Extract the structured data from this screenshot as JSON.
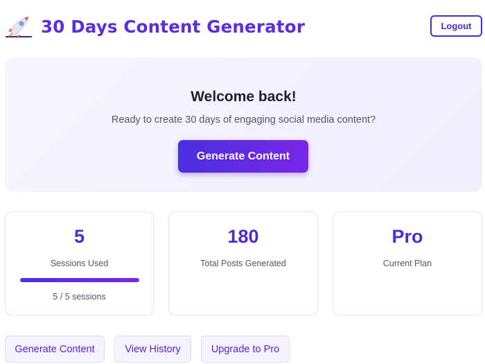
{
  "header": {
    "app_title": "30 Days Content Generator",
    "logo_icon": "rocket-icon",
    "logout_label": "Logout"
  },
  "welcome": {
    "title": "Welcome back!",
    "subtitle": "Ready to create 30 days of engaging social media content?",
    "generate_label": "Generate Content"
  },
  "stats": {
    "sessions": {
      "value": "5",
      "label": "Sessions Used",
      "progress_fraction": 1.0,
      "progress_text": "5 / 5 sessions"
    },
    "posts": {
      "value": "180",
      "label": "Total Posts Generated"
    },
    "plan": {
      "value": "Pro",
      "label": "Current Plan"
    }
  },
  "actions": [
    {
      "label": "Generate Content"
    },
    {
      "label": "View History"
    },
    {
      "label": "Upgrade to Pro"
    }
  ],
  "colors": {
    "accent": "#4c2bd1",
    "title": "#5a2ee0",
    "gradient_start": "#4a2fe0",
    "gradient_end": "#7a27e6"
  }
}
